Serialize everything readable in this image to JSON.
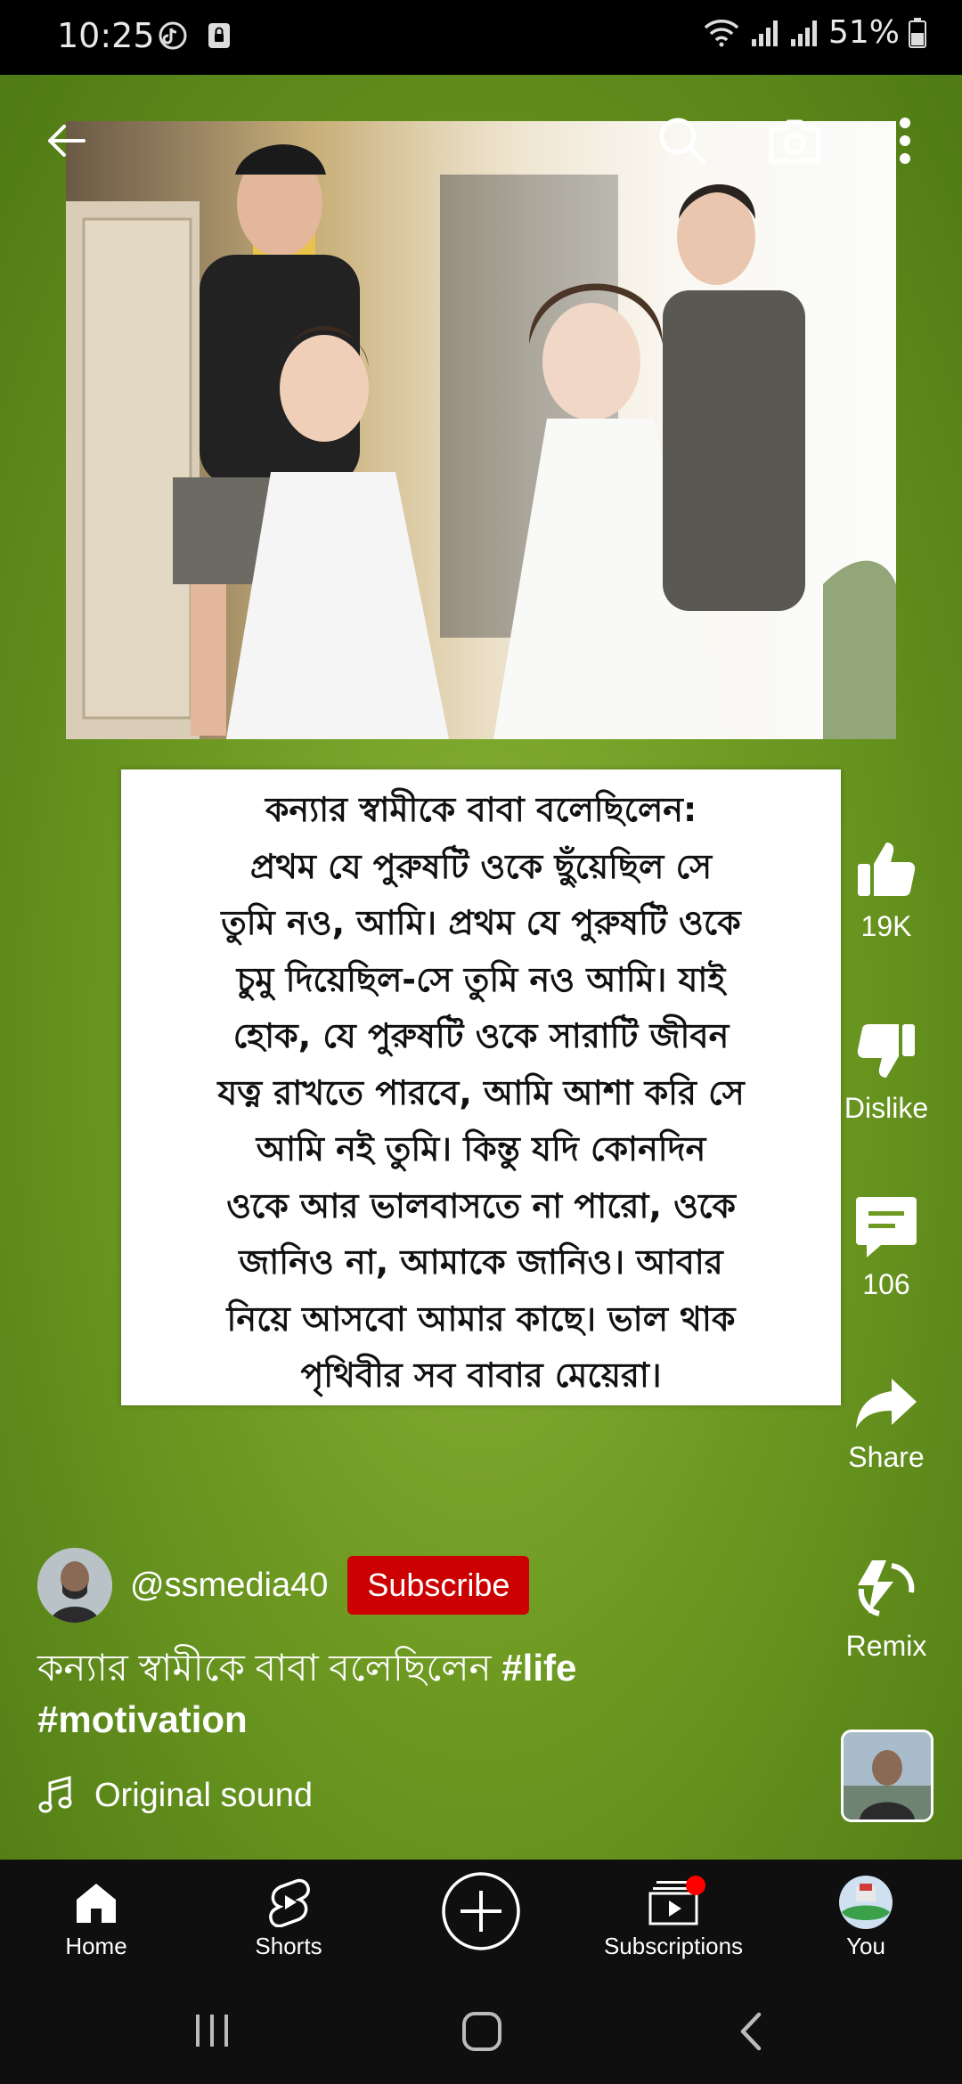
{
  "status_bar": {
    "time": "10:25",
    "battery": "51%"
  },
  "quote": {
    "lines": [
      "কন্যার স্বামীকে বাবা বলেছিলেন:",
      "প্রথম যে পুরুষটি ওকে ছুঁয়েছিল সে",
      "তুমি নও, আমি। প্রথম যে পুরুষটি ওকে",
      "চুমু দিয়েছিল-সে তুমি নও আমি। যাই",
      "হোক, যে পুরুষটি ওকে সারাটি জীবন",
      "যত্ন রাখতে পারবে, আমি আশা করি সে",
      "আমি নই তুমি। কিন্তু যদি কোনদিন",
      "ওকে আর ভালবাসতে না পারো, ওকে",
      "জানিও না, আমাকে জানিও। আবার",
      "নিয়ে আসবো আমার কাছে। ভাল থাক",
      "পৃথিবীর সব বাবার মেয়েরা।"
    ]
  },
  "actions": {
    "like_count": "19K",
    "dislike_label": "Dislike",
    "comment_count": "106",
    "share_label": "Share",
    "remix_label": "Remix"
  },
  "channel": {
    "handle": "@ssmedia40",
    "subscribe_label": "Subscribe"
  },
  "caption": {
    "text": "কন্যার স্বামীকে বাবা বলেছিলেন ",
    "tag1": "#life",
    "tag2": "#motivation"
  },
  "sound": {
    "label": "Original sound"
  },
  "bottom_nav": {
    "home": "Home",
    "shorts": "Shorts",
    "subscriptions": "Subscriptions",
    "you": "You"
  },
  "colors": {
    "subscribe": "#cc0000",
    "background": "#6e9a22"
  }
}
